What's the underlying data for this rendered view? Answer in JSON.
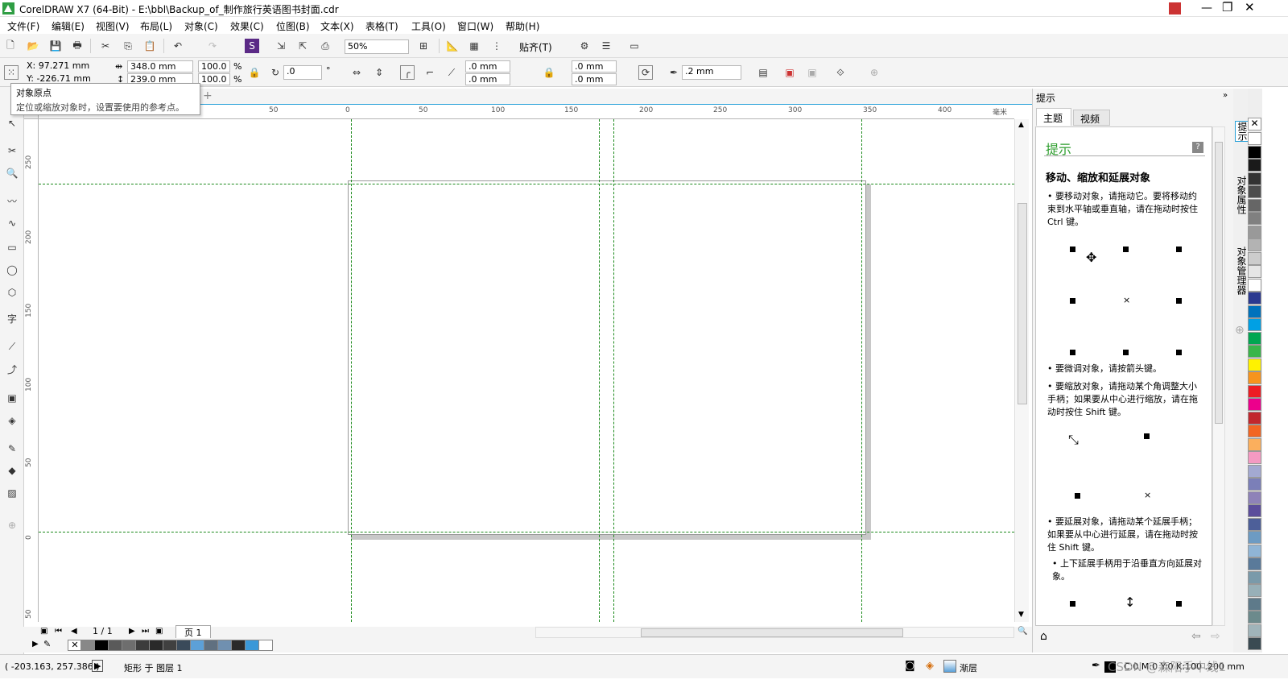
{
  "window": {
    "title": "CorelDRAW X7 (64-Bit) - E:\\bbl\\Backup_of_制作旅行英语图书封面.cdr"
  },
  "menu": [
    "文件(F)",
    "编辑(E)",
    "视图(V)",
    "布局(L)",
    "对象(C)",
    "效果(C)",
    "位图(B)",
    "文本(X)",
    "表格(T)",
    "工具(O)",
    "窗口(W)",
    "帮助(H)"
  ],
  "toolbar": {
    "zoom": "50%",
    "snap": "贴齐(T)"
  },
  "props": {
    "x": "X: 97.271 mm",
    "y": "Y: -226.71 mm",
    "w": "348.0 mm",
    "h": "239.0 mm",
    "sx": "100.0",
    "sy": "100.0",
    "pct": "%",
    "angle": ".0",
    "deg": "°",
    "r1": ".0 mm",
    "r2": ".0 mm",
    "r3": ".0 mm",
    "r4": ".0 mm",
    "outline": ".2 mm"
  },
  "tooltip": {
    "title": "对象原点",
    "text": "定位或缩放对象时，设置要使用的参考点。"
  },
  "ruler": {
    "h": [
      "50",
      "0",
      "50",
      "100",
      "150",
      "200",
      "250",
      "300",
      "350",
      "400"
    ],
    "hunit": "毫米",
    "v": [
      "250",
      "200",
      "150",
      "100",
      "50",
      "0",
      "50"
    ],
    "vunit": "毫米"
  },
  "pagenav": {
    "count": "1 / 1",
    "page": "页 1"
  },
  "docker": {
    "title": "提示",
    "tabs": [
      "主题",
      "视频"
    ],
    "heading": "提示",
    "subtitle": "移动、缩放和延展对象",
    "p1": "• 要移动对象，请拖动它。要将移动约束到水平轴或垂直轴，请在拖动时按住 Ctrl 键。",
    "p2": "• 要微调对象，请按箭头键。",
    "p3": "• 要缩放对象，请拖动某个角调整大小手柄；如果要从中心进行缩放，请在拖动时按住 Shift 键。",
    "p4": "• 要延展对象，请拖动某个延展手柄；如果要从中心进行延展，请在拖动时按住 Shift 键。",
    "p5": "• 上下延展手柄用于沿垂直方向延展对象。"
  },
  "vtabs": [
    "提示",
    "对象属性",
    "对象管理器"
  ],
  "status": {
    "coords": "( -203.163, 257.386 )",
    "info": "矩形 于 图层 1",
    "fill": "渐层",
    "cmyk": "C:0 M:0 Y:0 K:100 .200 mm",
    "watermark": "CSDN @森阳手中线1"
  },
  "palette_right": [
    "#ffffff",
    "#000000",
    "#1a1a1a",
    "#333333",
    "#4d4d4d",
    "#666666",
    "#808080",
    "#999999",
    "#b3b3b3",
    "#cccccc",
    "#e6e6e6",
    "#ffffff",
    "#2b3990",
    "#0072bc",
    "#00a0e4",
    "#00a651",
    "#39b54a",
    "#fff200",
    "#f7941d",
    "#ed1c24",
    "#ec008c",
    "#c1272d",
    "#f26522",
    "#fbaf5d",
    "#f49ac2",
    "#a3a9d1",
    "#7b7fb8",
    "#8e82b8",
    "#5b4d9b",
    "#4d5f99",
    "#6d9bc3",
    "#90b5d6",
    "#5a7a9a",
    "#7a9aaa",
    "#98b0b8",
    "#5e7a8a",
    "#6c8a8c",
    "#a0b4ba",
    "#3a4a52"
  ],
  "palette_doc": [
    "#888888",
    "#000000",
    "#5a5a5a",
    "#6e6e6e",
    "#3c3c3c",
    "#2a2a2a",
    "#404040",
    "#3a4a5a",
    "#5ca0d8",
    "#607080",
    "#7090b0",
    "#2a2a2a",
    "#3a98d8",
    "#ffffff"
  ]
}
